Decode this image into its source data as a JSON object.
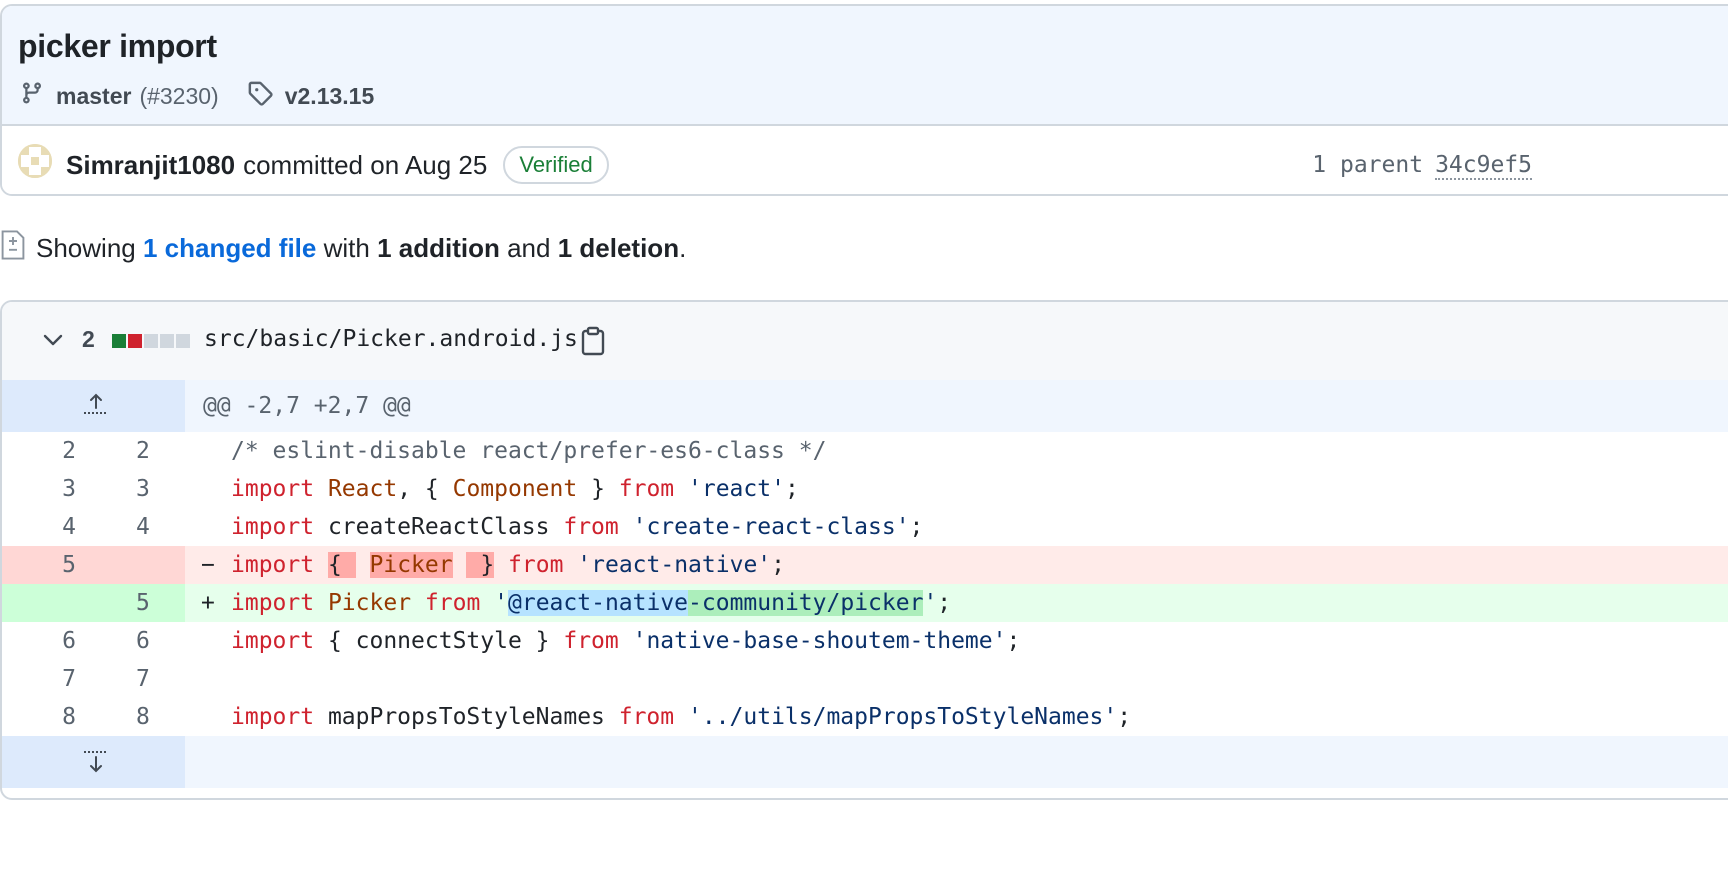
{
  "commit": {
    "title": "picker import",
    "branch": "master",
    "pr_number": "(#3230)",
    "tag": "v2.13.15",
    "author": "Simranjit1080",
    "committed_text": "committed on Aug 25",
    "verified_label": "Verified",
    "parent_label": "1 parent",
    "parent_sha": "34c9ef5"
  },
  "summary": {
    "prefix": "Showing",
    "changed_files_link": "1 changed file",
    "mid1": "with",
    "additions": "1 addition",
    "mid2": "and",
    "deletions": "1 deletion",
    "suffix": "."
  },
  "file": {
    "change_count": "2",
    "path": "src/basic/Picker.android.js",
    "diffstat_colors": [
      "#1a7f37",
      "#cf222e",
      "#d0d7de",
      "#d0d7de",
      "#d0d7de"
    ],
    "hunk_header": "@@ -2,7 +2,7 @@",
    "lines": [
      {
        "old": "2",
        "new": "2",
        "marker": " ",
        "code": "/* eslint-disable react/prefer-es6-class */"
      },
      {
        "old": "3",
        "new": "3",
        "marker": " ",
        "code": "import React, { Component } from 'react';"
      },
      {
        "old": "4",
        "new": "4",
        "marker": " ",
        "code": "import createReactClass from 'create-react-class';"
      },
      {
        "old": "5",
        "new": "",
        "marker": "-",
        "code": "import { Picker } from 'react-native';"
      },
      {
        "old": "",
        "new": "5",
        "marker": "+",
        "code": "import Picker from '@react-native-community/picker';"
      },
      {
        "old": "6",
        "new": "6",
        "marker": " ",
        "code": "import { connectStyle } from 'native-base-shoutem-theme';"
      },
      {
        "old": "7",
        "new": "7",
        "marker": " ",
        "code": ""
      },
      {
        "old": "8",
        "new": "8",
        "marker": " ",
        "code": "import mapPropsToStyleNames from '../utils/mapPropsToStyleNames';"
      }
    ]
  },
  "colors": {
    "verified_green": "#1a7f37",
    "link_blue": "#0969da",
    "keyword_red": "#cf222e",
    "string_navy": "#0a3069",
    "identifier_orange": "#953800"
  },
  "icons": [
    "git-branch-icon",
    "tag-icon",
    "file-diff-icon",
    "chevron-down-icon",
    "copy-icon",
    "expand-up-icon",
    "expand-down-icon"
  ]
}
